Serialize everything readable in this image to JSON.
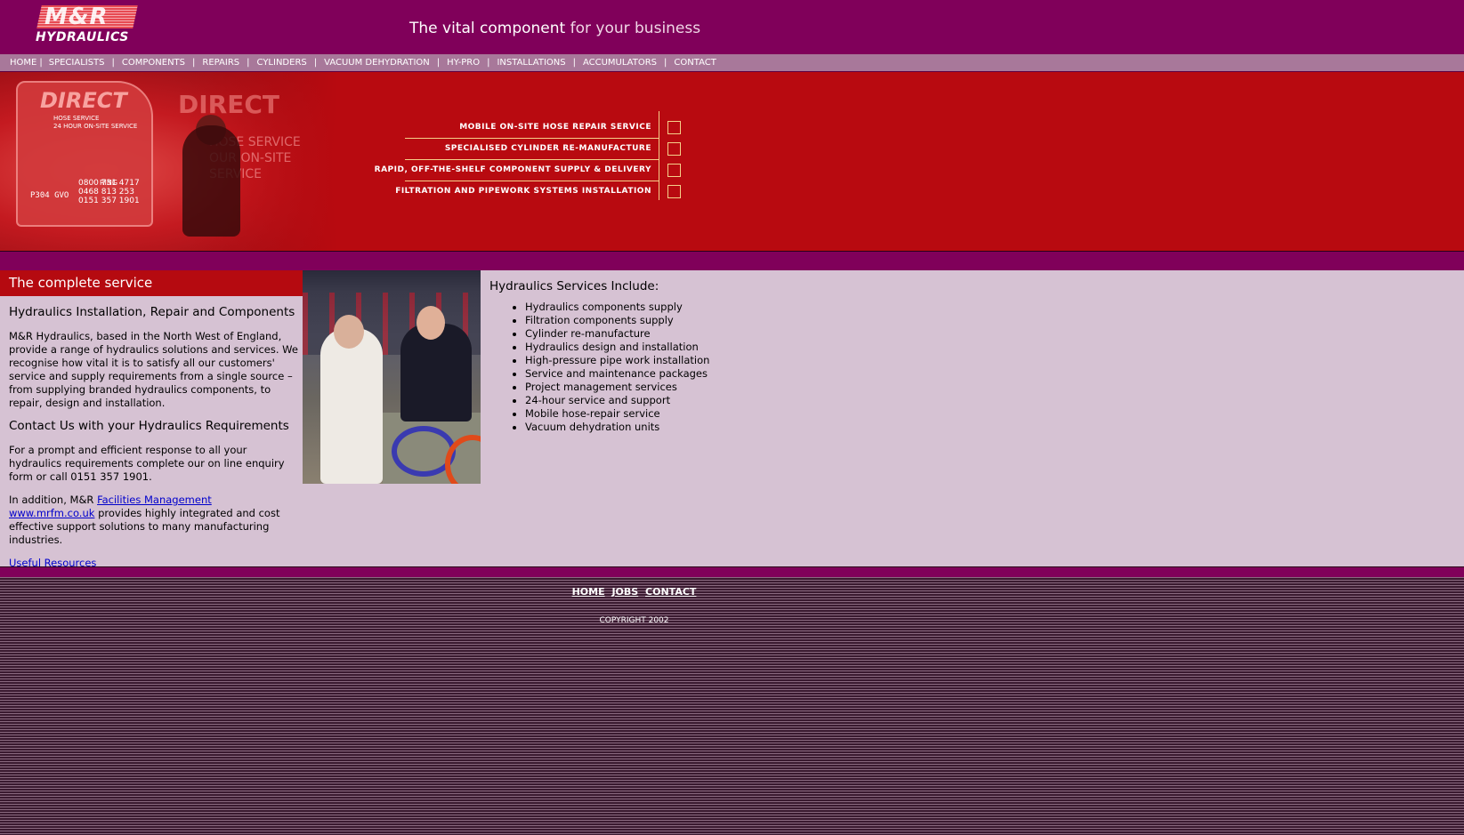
{
  "header": {
    "logo_mark": "M&R",
    "logo_name": "HYDRAULICS",
    "tagline_bold": "The vital component",
    "tagline_light": "for your business"
  },
  "nav": {
    "items": [
      "HOME",
      "SPECIALISTS",
      "COMPONENTS",
      "REPAIRS",
      "CYLINDERS",
      "VACUUM DEHYDRATION",
      "HY-PRO",
      "INSTALLATIONS",
      "ACCUMULATORS",
      "CONTACT"
    ],
    "separator": "|"
  },
  "banner": {
    "van_brand": "DIRECT",
    "van_service": "HOSE SERVICE\n24 HOUR ON-SITE SERVICE",
    "van_ring": "RING",
    "van_phone": "0800 731 4717\n0468 813 253\n0151 357 1901",
    "van_plate": "P304 GVO",
    "van_brand2": "DIRECT",
    "van_sub2": "HOSE SERVICE\nOUR ON-SITE SERVICE",
    "services": [
      "MOBILE ON-SITE HOSE REPAIR SERVICE",
      "SPECIALISED CYLINDER RE-MANUFACTURE",
      "RAPID, OFF-THE-SHELF COMPONENT SUPPLY & DELIVERY",
      "FILTRATION AND PIPEWORK SYSTEMS INSTALLATION"
    ]
  },
  "content": {
    "section_title": "The complete service",
    "heading1": "Hydraulics Installation, Repair and Components",
    "para1": "M&R Hydraulics, based in the North West of England, provide a range of hydraulics solutions and services. We recognise how vital it is to satisfy all our customers' service and supply requirements from a single source – from supplying branded hydraulics components, to repair, design and installation.",
    "heading2": "Contact Us with your Hydraulics Requirements",
    "para2": "For a prompt and efficient response to all your hydraulics requirements complete our on line enquiry form or call 0151 357 1901.",
    "para3_prefix": "In addition, M&R",
    "link_fm": "Facilities Management",
    "link_site": "www.mrfm.co.uk",
    "para3_suffix": "provides highly integrated and cost effective support solutions to many manufacturing industries.",
    "link_resources": "Useful Resources",
    "services_heading": "Hydraulics Services Include:",
    "services_list": [
      "Hydraulics components supply",
      "Filtration components supply",
      "Cylinder re-manufacture",
      "Hydraulics design and installation",
      "High-pressure pipe work installation",
      "Service and maintenance packages",
      "Project management services",
      "24-hour service and support",
      "Mobile hose-repair service",
      "Vacuum dehydration units"
    ]
  },
  "footer": {
    "links": [
      "HOME",
      "JOBS",
      "CONTACT"
    ],
    "copyright": "COPYRIGHT 2002"
  }
}
